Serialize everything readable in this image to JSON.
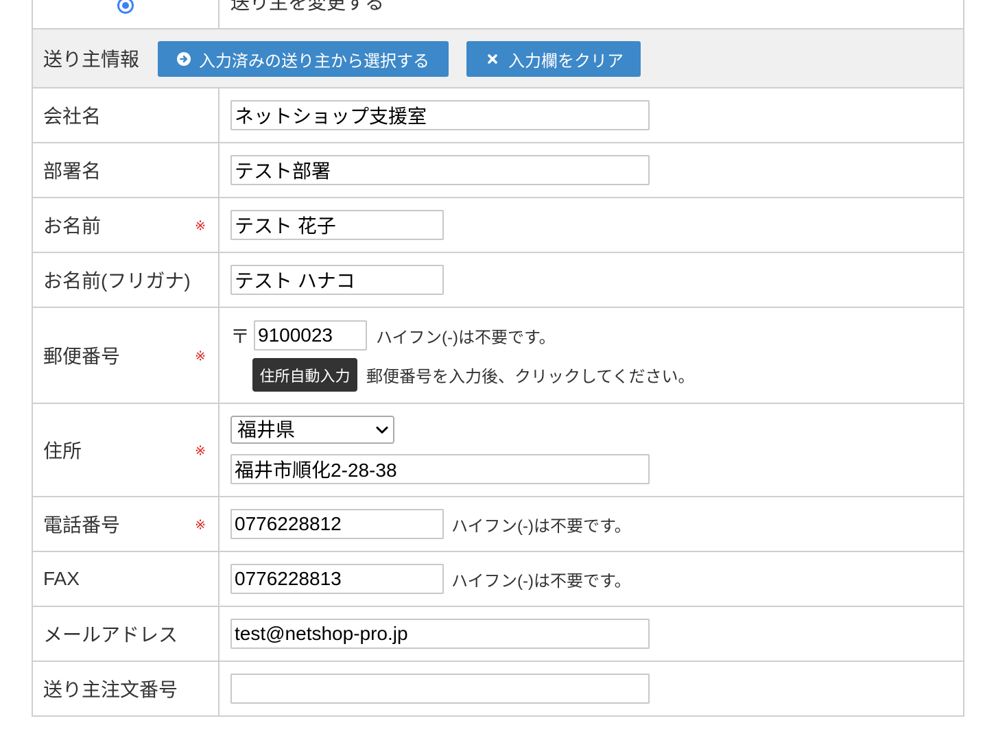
{
  "change_row": {
    "label": "送り主を変更する",
    "selected": true
  },
  "header": {
    "title": "送り主情報",
    "select_sender_button": "入力済みの送り主から選択する",
    "clear_button": "入力欄をクリア"
  },
  "required_mark": "※",
  "fields": {
    "company": {
      "label": "会社名",
      "value": "ネットショップ支援室"
    },
    "department": {
      "label": "部署名",
      "value": "テスト部署"
    },
    "name": {
      "label": "お名前",
      "value": "テスト 花子"
    },
    "name_kana": {
      "label": "お名前(フリガナ)",
      "value": "テスト ハナコ"
    },
    "postal_code": {
      "label": "郵便番号",
      "symbol": "〒",
      "value": "9100023",
      "note": "ハイフン(-)は不要です。",
      "auto_fill_button": "住所自動入力",
      "auto_fill_note": "郵便番号を入力後、クリックしてください。"
    },
    "address": {
      "label": "住所",
      "prefecture": "福井県",
      "value": "福井市順化2-28-38"
    },
    "tel": {
      "label": "電話番号",
      "value": "0776228812",
      "note": "ハイフン(-)は不要です。"
    },
    "fax": {
      "label": "FAX",
      "value": "0776228813",
      "note": "ハイフン(-)は不要です。"
    },
    "email": {
      "label": "メールアドレス",
      "value": "test@netshop-pro.jp"
    },
    "sender_order_number": {
      "label": "送り主注文番号",
      "value": ""
    }
  },
  "icons": {
    "select_sender_button": "arrow-circle-right-icon",
    "clear_button": "times-icon",
    "prefecture_select": "chevron-down-icon"
  },
  "colors": {
    "primary_button": "#3d88c8",
    "dark_button": "#333333",
    "required_mark": "#e0261f",
    "header_background": "#f0f0f0",
    "border": "#cfcfcf",
    "radio": "#3b82f6"
  }
}
